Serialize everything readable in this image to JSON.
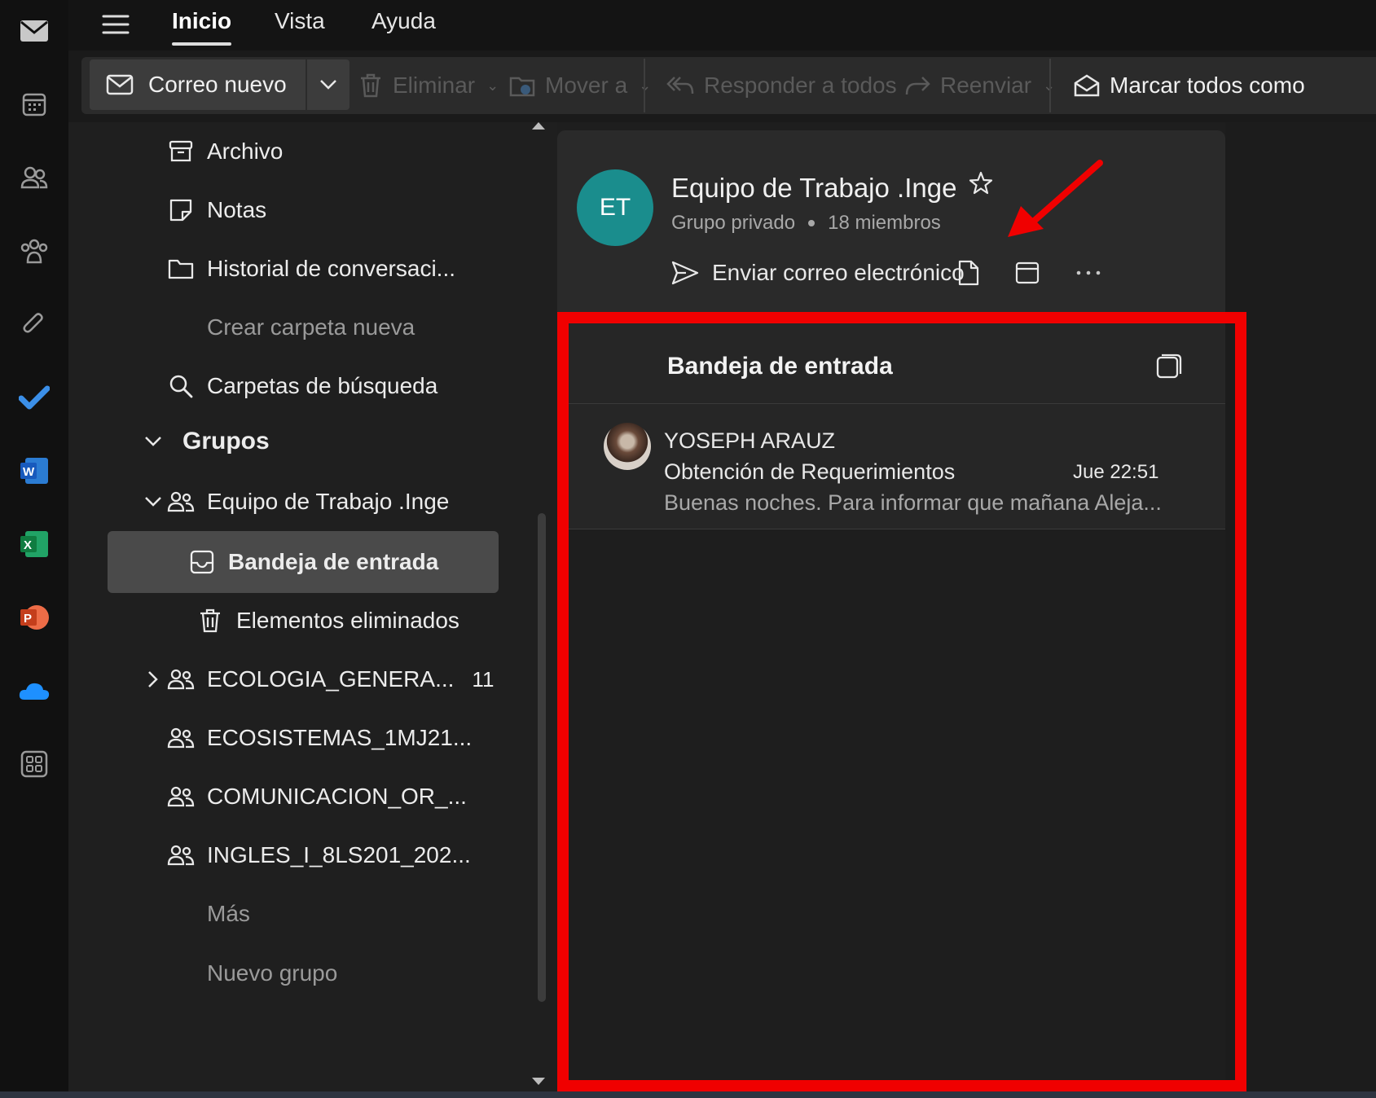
{
  "top_menu": {
    "tabs": [
      {
        "label": "Inicio",
        "active": true
      },
      {
        "label": "Vista",
        "active": false
      },
      {
        "label": "Ayuda",
        "active": false
      }
    ]
  },
  "ribbon": {
    "new_mail": "Correo nuevo",
    "delete": "Eliminar",
    "move_to": "Mover a",
    "reply_all": "Responder a todos",
    "forward": "Reenviar",
    "mark_all": "Marcar todos como"
  },
  "folders": {
    "items": [
      {
        "label": "Archivo",
        "icon": "archive-icon"
      },
      {
        "label": "Notas",
        "icon": "notes-icon"
      },
      {
        "label": "Historial de conversaci...",
        "icon": "folder-icon"
      },
      {
        "label": "Crear carpeta nueva"
      },
      {
        "label": "Carpetas de búsqueda",
        "icon": "search-icon"
      }
    ],
    "groups_header": "Grupos",
    "group_open": "Equipo de Trabajo .Inge",
    "inbox": "Bandeja de entrada",
    "deleted": "Elementos eliminados",
    "other_groups": [
      {
        "label": "ECOLOGIA_GENERA...",
        "count": "11"
      },
      {
        "label": "ECOSISTEMAS_1MJ21..."
      },
      {
        "label": "COMUNICACION_OR_..."
      },
      {
        "label": "INGLES_I_8LS201_202..."
      }
    ],
    "more": "Más",
    "new_group": "Nuevo grupo"
  },
  "group_card": {
    "initials": "ET",
    "name": "Equipo de Trabajo .Inge",
    "privacy": "Grupo privado",
    "members": "18 miembros",
    "send_email": "Enviar correo electrónico"
  },
  "inbox": {
    "title": "Bandeja de entrada",
    "messages": [
      {
        "from": "YOSEPH ARAUZ",
        "subject": "Obtención de Requerimientos",
        "time": "Jue 22:51",
        "preview": "Buenas noches. Para informar que mañana Aleja..."
      }
    ]
  },
  "colors": {
    "avatar": "#1a8d8d",
    "highlight": "#f00000",
    "selected_folder": "#4a4a4a",
    "background": "#1e1e1e"
  }
}
